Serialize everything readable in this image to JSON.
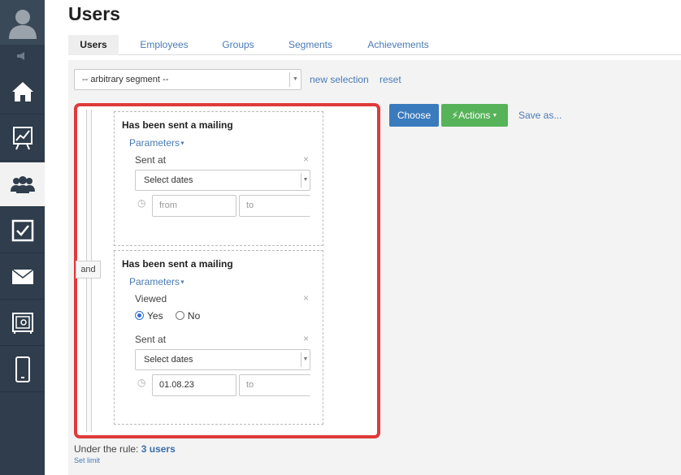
{
  "page": {
    "title": "Users"
  },
  "tabs": [
    {
      "label": "Users",
      "active": true
    },
    {
      "label": "Employees",
      "active": false
    },
    {
      "label": "Groups",
      "active": false
    },
    {
      "label": "Segments",
      "active": false
    },
    {
      "label": "Achievements",
      "active": false
    }
  ],
  "sidebar": {
    "items": [
      {
        "icon": "home-icon"
      },
      {
        "icon": "chart-icon"
      },
      {
        "icon": "users-icon",
        "active": true
      },
      {
        "icon": "checkbox-icon"
      },
      {
        "icon": "mail-icon"
      },
      {
        "icon": "safe-icon"
      },
      {
        "icon": "phone-icon"
      }
    ]
  },
  "segment": {
    "selected": "-- arbitrary segment --",
    "new_selection": "new selection",
    "reset": "reset"
  },
  "toolbar": {
    "choose": "Choose",
    "actions": "Actions",
    "save_as": "Save as..."
  },
  "rules": {
    "connector": "and",
    "items": [
      {
        "title": "Has been sent a mailing",
        "params_label": "Parameters",
        "sent_at_label": "Sent at",
        "dates_select": "Select dates",
        "from_placeholder": "from",
        "to_placeholder": "to"
      },
      {
        "title": "Has been sent a mailing",
        "params_label": "Parameters",
        "viewed_label": "Viewed",
        "yes_label": "Yes",
        "no_label": "No",
        "viewed_value": "Yes",
        "sent_at_label": "Sent at",
        "dates_select": "Select dates",
        "from_value": "01.08.23",
        "to_placeholder": "to"
      }
    ]
  },
  "summary": {
    "prefix": "Under the rule:",
    "count": "3 users",
    "set_limit": "Set limit"
  },
  "colors": {
    "sidebar": "#2f3d4c",
    "link": "#4a7bb5",
    "choose": "#3a7bbd",
    "actions": "#57b35a",
    "highlight": "#e03a3a"
  }
}
